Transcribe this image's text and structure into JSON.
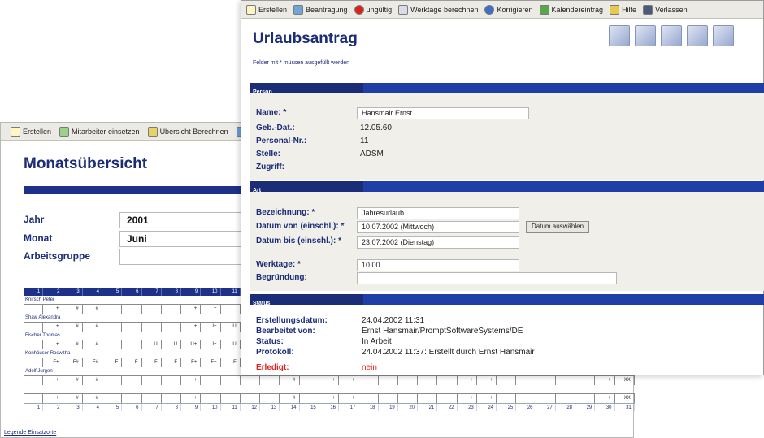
{
  "back": {
    "toolbar": [
      "Erstellen",
      "Mitarbeiter einsetzen",
      "Übersicht Berechnen",
      "D"
    ],
    "title": "Monatsübersicht",
    "fields": {
      "jahr_label": "Jahr",
      "jahr_value": "2001",
      "monat_label": "Monat",
      "monat_value": "Juni",
      "gruppe_label": "Arbeitsgruppe"
    },
    "day_header": [
      "1",
      "2",
      "3",
      "4",
      "5",
      "6",
      "7",
      "8",
      "9",
      "10",
      "11"
    ],
    "people": [
      {
        "name": "Knirsch Peter",
        "cells": [
          "",
          "+",
          "#",
          "#",
          "",
          "",
          "",
          "",
          "+",
          "+",
          "",
          "",
          "",
          "",
          "",
          "",
          "",
          "",
          "",
          "",
          "",
          "",
          "",
          "",
          "",
          "",
          "",
          "",
          "",
          "",
          ""
        ]
      },
      {
        "name": "Shaw Alexandra",
        "cells": [
          "",
          "+",
          "#",
          "#",
          "",
          "",
          "",
          "",
          "+",
          "U+",
          "U",
          "",
          "",
          "",
          "",
          "",
          "",
          "",
          "",
          "",
          "",
          "",
          "",
          "",
          "",
          "",
          "",
          "",
          "",
          "",
          ""
        ]
      },
      {
        "name": "Fischer Thomas",
        "cells": [
          "",
          "+",
          "#",
          "#",
          "",
          "",
          "U",
          "U",
          "U+",
          "U+",
          "U",
          "",
          "",
          "",
          "",
          "",
          "",
          "",
          "",
          "",
          "",
          "",
          "",
          "",
          "",
          "",
          "",
          "",
          "",
          "",
          ""
        ]
      },
      {
        "name": "Konhäuser Roswitha",
        "cells": [
          "",
          "F+",
          "F#",
          "F#",
          "F",
          "F",
          "F",
          "F",
          "F+",
          "F+",
          "F",
          "",
          "",
          "",
          "",
          "",
          "",
          "",
          "",
          "",
          "",
          "",
          "",
          "",
          "",
          "",
          "",
          "",
          "",
          "",
          ""
        ]
      },
      {
        "name": "Adolf Jurgen",
        "cells": [
          "",
          "+",
          "#",
          "#",
          "",
          "",
          "",
          "",
          "+",
          "+",
          "",
          "",
          "",
          "#",
          "",
          "+",
          "+",
          "",
          "",
          "",
          "",
          "",
          "+",
          "+",
          "",
          "",
          "",
          "",
          "",
          "+",
          "XX"
        ]
      },
      {
        "name": "",
        "cells": [
          "",
          "+",
          "#",
          "#",
          "",
          "",
          "",
          "",
          "+",
          "+",
          "",
          "",
          "",
          "#",
          "",
          "+",
          "+",
          "",
          "",
          "",
          "",
          "",
          "+",
          "+",
          "",
          "",
          "",
          "",
          "",
          "+",
          "XX"
        ]
      }
    ],
    "day_footer": [
      "1",
      "2",
      "3",
      "4",
      "5",
      "6",
      "7",
      "8",
      "9",
      "10",
      "11",
      "12",
      "13",
      "14",
      "15",
      "16",
      "17",
      "18",
      "19",
      "20",
      "21",
      "22",
      "23",
      "24",
      "25",
      "26",
      "27",
      "28",
      "29",
      "30",
      "31"
    ],
    "legend": "Legende Einsatzorte"
  },
  "front": {
    "toolbar": [
      "Erstellen",
      "Beantragung",
      "ungültig",
      "Werktage berechnen",
      "Korrigieren",
      "Kalendereintrag",
      "Hilfe",
      "Verlassen"
    ],
    "title": "Urlaubsantrag",
    "note": "Felder mit * müssen ausgefüllt werden",
    "sections": {
      "person": "Person",
      "art": "Art",
      "status": "Status"
    },
    "person": {
      "name_label": "Name: *",
      "name_value": "Hansmair Ernst",
      "geb_label": "Geb.-Dat.:",
      "geb_value": "12.05.60",
      "pers_label": "Personal-Nr.:",
      "pers_value": "11",
      "stelle_label": "Stelle:",
      "stelle_value": "ADSM",
      "zugriff_label": "Zugriff:"
    },
    "art": {
      "bez_label": "Bezeichnung: *",
      "bez_value": "Jahresurlaub",
      "von_label": "Datum von (einschl.): *",
      "von_value": "10.07.2002",
      "von_day": "(Mittwoch)",
      "datum_button": "Datum auswählen",
      "bis_label": "Datum bis (einschl.): *",
      "bis_value": "23.07.2002",
      "bis_day": "(Dienstag)",
      "werk_label": "Werktage: *",
      "werk_value": "10,00",
      "begr_label": "Begründung:"
    },
    "status": {
      "erst_label": "Erstellungsdatum:",
      "erst_value": "24.04.2002 11:31",
      "bearb_label": "Bearbeitet von:",
      "bearb_value": "Ernst Hansmair/PromptSoftwareSystems/DE",
      "status_label": "Status:",
      "status_value": "In Arbeit",
      "prot_label": "Protokoll:",
      "prot_value": "24.04.2002 11:37: Erstellt durch Ernst Hansmair",
      "erl_label": "Erledigt:",
      "erl_value": "nein"
    }
  },
  "colors": {
    "brand": "#1c2d78",
    "bar": "#1c3187",
    "alert": "#e0201a"
  }
}
